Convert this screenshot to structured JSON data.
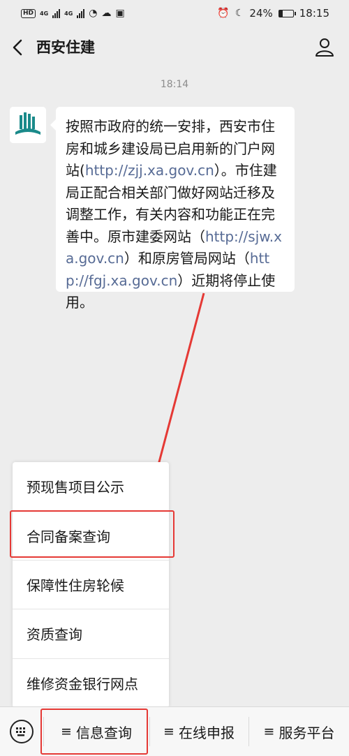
{
  "status_bar": {
    "hd": "HD",
    "net1": "4G",
    "net2": "4G",
    "battery": "24%",
    "time": "18:15"
  },
  "nav": {
    "title": "西安住建"
  },
  "chat": {
    "timestamp": "18:14",
    "message": {
      "t1": "按照市政府的统一安排，西安市住房和城乡建设局已启用新的门户网站(",
      "link1": "http://zjj.xa.gov.cn",
      "t2": "）。市住建局正配合相关部门做好网站迁移及调整工作，有关内容和功能正在完善中。原市建委网站（",
      "link2": "http://sjw.xa.gov.cn",
      "t3": "）和原房管局网站（",
      "link3": "http://fgj.xa.gov.cn",
      "t4": "）近期将停止使用。"
    }
  },
  "menu": {
    "items": [
      {
        "label": "预现售项目公示"
      },
      {
        "label": "合同备案查询"
      },
      {
        "label": "保障性住房轮候"
      },
      {
        "label": "资质查询"
      },
      {
        "label": "维修资金银行网点"
      }
    ]
  },
  "bottom_bar": {
    "tabs": [
      {
        "label": "信息查询"
      },
      {
        "label": "在线申报"
      },
      {
        "label": "服务平台"
      }
    ],
    "menu_glyph": "≡"
  },
  "colors": {
    "link": "#576b95",
    "highlight": "#e53935",
    "background": "#ededed",
    "logo_teal": "#1a8a8a"
  }
}
